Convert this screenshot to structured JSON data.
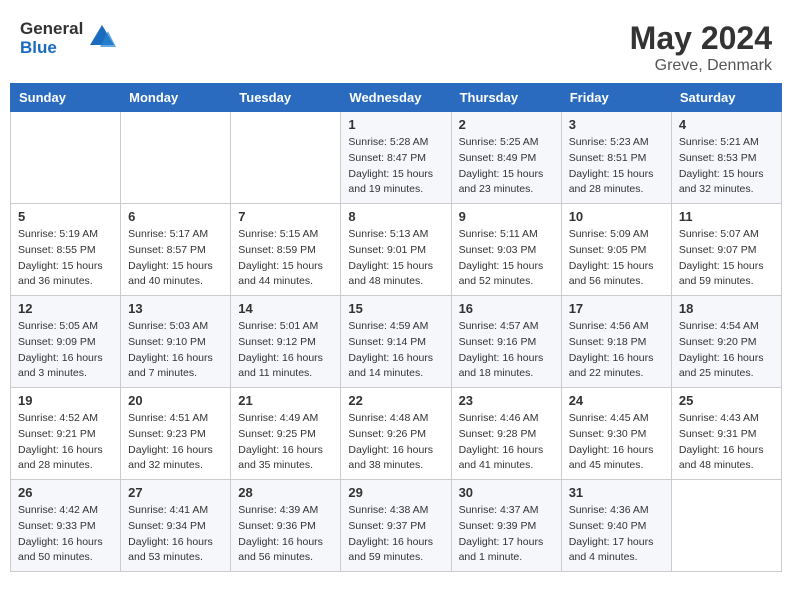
{
  "header": {
    "logo_general": "General",
    "logo_blue": "Blue",
    "month_year": "May 2024",
    "location": "Greve, Denmark"
  },
  "weekdays": [
    "Sunday",
    "Monday",
    "Tuesday",
    "Wednesday",
    "Thursday",
    "Friday",
    "Saturday"
  ],
  "weeks": [
    [
      {
        "day": "",
        "info": ""
      },
      {
        "day": "",
        "info": ""
      },
      {
        "day": "",
        "info": ""
      },
      {
        "day": "1",
        "info": "Sunrise: 5:28 AM\nSunset: 8:47 PM\nDaylight: 15 hours\nand 19 minutes."
      },
      {
        "day": "2",
        "info": "Sunrise: 5:25 AM\nSunset: 8:49 PM\nDaylight: 15 hours\nand 23 minutes."
      },
      {
        "day": "3",
        "info": "Sunrise: 5:23 AM\nSunset: 8:51 PM\nDaylight: 15 hours\nand 28 minutes."
      },
      {
        "day": "4",
        "info": "Sunrise: 5:21 AM\nSunset: 8:53 PM\nDaylight: 15 hours\nand 32 minutes."
      }
    ],
    [
      {
        "day": "5",
        "info": "Sunrise: 5:19 AM\nSunset: 8:55 PM\nDaylight: 15 hours\nand 36 minutes."
      },
      {
        "day": "6",
        "info": "Sunrise: 5:17 AM\nSunset: 8:57 PM\nDaylight: 15 hours\nand 40 minutes."
      },
      {
        "day": "7",
        "info": "Sunrise: 5:15 AM\nSunset: 8:59 PM\nDaylight: 15 hours\nand 44 minutes."
      },
      {
        "day": "8",
        "info": "Sunrise: 5:13 AM\nSunset: 9:01 PM\nDaylight: 15 hours\nand 48 minutes."
      },
      {
        "day": "9",
        "info": "Sunrise: 5:11 AM\nSunset: 9:03 PM\nDaylight: 15 hours\nand 52 minutes."
      },
      {
        "day": "10",
        "info": "Sunrise: 5:09 AM\nSunset: 9:05 PM\nDaylight: 15 hours\nand 56 minutes."
      },
      {
        "day": "11",
        "info": "Sunrise: 5:07 AM\nSunset: 9:07 PM\nDaylight: 15 hours\nand 59 minutes."
      }
    ],
    [
      {
        "day": "12",
        "info": "Sunrise: 5:05 AM\nSunset: 9:09 PM\nDaylight: 16 hours\nand 3 minutes."
      },
      {
        "day": "13",
        "info": "Sunrise: 5:03 AM\nSunset: 9:10 PM\nDaylight: 16 hours\nand 7 minutes."
      },
      {
        "day": "14",
        "info": "Sunrise: 5:01 AM\nSunset: 9:12 PM\nDaylight: 16 hours\nand 11 minutes."
      },
      {
        "day": "15",
        "info": "Sunrise: 4:59 AM\nSunset: 9:14 PM\nDaylight: 16 hours\nand 14 minutes."
      },
      {
        "day": "16",
        "info": "Sunrise: 4:57 AM\nSunset: 9:16 PM\nDaylight: 16 hours\nand 18 minutes."
      },
      {
        "day": "17",
        "info": "Sunrise: 4:56 AM\nSunset: 9:18 PM\nDaylight: 16 hours\nand 22 minutes."
      },
      {
        "day": "18",
        "info": "Sunrise: 4:54 AM\nSunset: 9:20 PM\nDaylight: 16 hours\nand 25 minutes."
      }
    ],
    [
      {
        "day": "19",
        "info": "Sunrise: 4:52 AM\nSunset: 9:21 PM\nDaylight: 16 hours\nand 28 minutes."
      },
      {
        "day": "20",
        "info": "Sunrise: 4:51 AM\nSunset: 9:23 PM\nDaylight: 16 hours\nand 32 minutes."
      },
      {
        "day": "21",
        "info": "Sunrise: 4:49 AM\nSunset: 9:25 PM\nDaylight: 16 hours\nand 35 minutes."
      },
      {
        "day": "22",
        "info": "Sunrise: 4:48 AM\nSunset: 9:26 PM\nDaylight: 16 hours\nand 38 minutes."
      },
      {
        "day": "23",
        "info": "Sunrise: 4:46 AM\nSunset: 9:28 PM\nDaylight: 16 hours\nand 41 minutes."
      },
      {
        "day": "24",
        "info": "Sunrise: 4:45 AM\nSunset: 9:30 PM\nDaylight: 16 hours\nand 45 minutes."
      },
      {
        "day": "25",
        "info": "Sunrise: 4:43 AM\nSunset: 9:31 PM\nDaylight: 16 hours\nand 48 minutes."
      }
    ],
    [
      {
        "day": "26",
        "info": "Sunrise: 4:42 AM\nSunset: 9:33 PM\nDaylight: 16 hours\nand 50 minutes."
      },
      {
        "day": "27",
        "info": "Sunrise: 4:41 AM\nSunset: 9:34 PM\nDaylight: 16 hours\nand 53 minutes."
      },
      {
        "day": "28",
        "info": "Sunrise: 4:39 AM\nSunset: 9:36 PM\nDaylight: 16 hours\nand 56 minutes."
      },
      {
        "day": "29",
        "info": "Sunrise: 4:38 AM\nSunset: 9:37 PM\nDaylight: 16 hours\nand 59 minutes."
      },
      {
        "day": "30",
        "info": "Sunrise: 4:37 AM\nSunset: 9:39 PM\nDaylight: 17 hours\nand 1 minute."
      },
      {
        "day": "31",
        "info": "Sunrise: 4:36 AM\nSunset: 9:40 PM\nDaylight: 17 hours\nand 4 minutes."
      },
      {
        "day": "",
        "info": ""
      }
    ]
  ]
}
